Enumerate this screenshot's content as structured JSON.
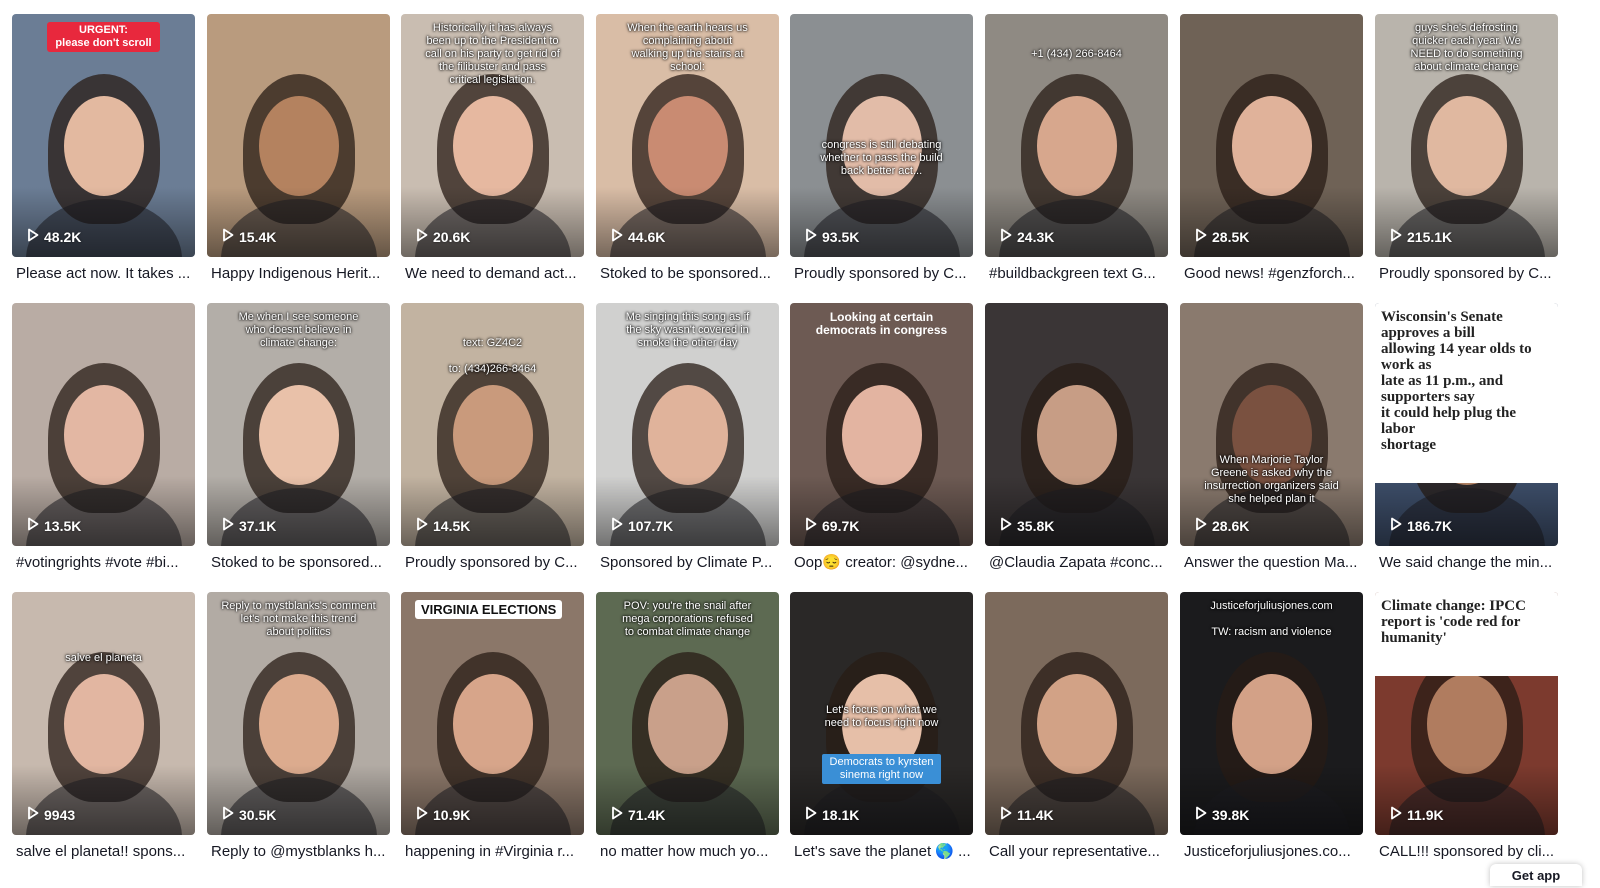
{
  "videos": [
    {
      "views": "48.2K",
      "caption": "Please act now. It takes ...",
      "overlay": "URGENT:\nplease don't scroll",
      "bg": "#6b7d95",
      "skin": "#e3b9a0"
    },
    {
      "views": "15.4K",
      "caption": "Happy Indigenous Herit...",
      "overlay": "",
      "bg": "#b99b7e",
      "skin": "#b4825f"
    },
    {
      "views": "20.6K",
      "caption": "We need to demand act...",
      "overlay": "Historically it has always\nbeen up to the President to\ncall on his party to get rid of\nthe filibuster and pass\ncritical legislation.",
      "bg": "#c9bdb1",
      "skin": "#e6b8a0"
    },
    {
      "views": "44.6K",
      "caption": "Stoked to be sponsored...",
      "overlay": "When the earth hears us\ncomplaining about\nwalking up the stairs at\nschool:",
      "bg": "#d9bda6",
      "skin": "#c98b72"
    },
    {
      "views": "93.5K",
      "caption": "Proudly sponsored by C...",
      "overlay": "\n\n\n\n\n\n\n\n\ncongress is still debating\nwhether to pass the build\nback better act...",
      "bg": "#8b8f92",
      "skin": "#e2bca8"
    },
    {
      "views": "24.3K",
      "caption": "#buildbackgreen text G...",
      "overlay": "\n\n+1 (434) 266-8464",
      "bg": "#8f8a83",
      "skin": "#d7a78d"
    },
    {
      "views": "28.5K",
      "caption": "Good news! #genzforch...",
      "overlay": "",
      "bg": "#6f6256",
      "skin": "#e0b29a"
    },
    {
      "views": "215.1K",
      "caption": "Proudly sponsored by C...",
      "overlay": "guys she's defrosting\nquicker each year. We\nNEED to do something\nabout climate change",
      "bg": "#b9b4ac",
      "skin": "#e0b8a0"
    },
    {
      "views": "13.5K",
      "caption": "#votingrights #vote #bi...",
      "overlay": "",
      "bg": "#b9aca4",
      "skin": "#e3b7a3"
    },
    {
      "views": "37.1K",
      "caption": "Stoked to be sponsored...",
      "overlay": "Me when I see someone\nwho doesnt believe in\nclimate change:",
      "bg": "#b3aea8",
      "skin": "#e9c1a9"
    },
    {
      "views": "14.5K",
      "caption": "Proudly sponsored by C...",
      "overlay": "\n\ntext: GZ4C2\n\n    to: (434)266-8464",
      "bg": "#c2b3a1",
      "skin": "#c99a7c"
    },
    {
      "views": "107.7K",
      "caption": "Sponsored by Climate P...",
      "overlay": "Me singing this song as if\nthe sky wasn't covered in\nsmoke the other day",
      "bg": "#d0d0cf",
      "skin": "#e0b39b"
    },
    {
      "views": "69.7K",
      "caption": "Oop😔 creator: @sydne...",
      "overlay": "Looking at certain\ndemocrats in congress",
      "bg": "#6d5a53",
      "skin": "#e3b4a1"
    },
    {
      "views": "35.8K",
      "caption": "@Claudia Zapata #conc...",
      "overlay": "",
      "bg": "#3a3536",
      "skin": "#c79d85"
    },
    {
      "views": "28.6K",
      "caption": "Answer the question Ma...",
      "overlay": "\n\n\n\n\n\n\n\n\n\n\nWhen Marjorie Taylor\nGreene is asked why the\ninsurrection organizers said\nshe helped plan it",
      "bg": "#8a7a6e",
      "skin": "#7a5140"
    },
    {
      "views": "186.7K",
      "caption": "We said change the min...",
      "overlay": "Wisconsin's Senate approves a bill\nallowing 14 year olds to work as\nlate as 11 p.m., and supporters say\nit could help plug the labor\nshortage",
      "bg": "#3e4f6b",
      "skin": "#b48466"
    },
    {
      "views": "9943",
      "caption": "salve el planeta!! spons...",
      "overlay": "\n\n\n\nsalve el planeta",
      "bg": "#c7b9ae",
      "skin": "#e2b6a1"
    },
    {
      "views": "30.5K",
      "caption": "Reply to @mystblanks h...",
      "overlay": "Reply to mystblanks's comment\nlet's not make this trend\nabout politics",
      "bg": "#b2aba4",
      "skin": "#dcab8e"
    },
    {
      "views": "10.9K",
      "caption": "happening in #Virginia r...",
      "overlay": "VIRGINIA ELECTIONS",
      "bg": "#8b7769",
      "skin": "#d7a58a"
    },
    {
      "views": "71.4K",
      "caption": "no matter how much yo...",
      "overlay": "POV: you're the snail after\nmega corporations refused\nto combat climate change",
      "bg": "#5d6a52",
      "skin": "#c9a08a"
    },
    {
      "views": "18.1K",
      "caption": "Let's save the planet 🌎 ...",
      "overlay": "\n\n\n\n\n\n\n\nLet's focus on what we\nneed to focus right now",
      "bg": "#2a2827",
      "skin": "#e6bfa8"
    },
    {
      "views": "11.4K",
      "caption": "Call your representative...",
      "overlay": "",
      "bg": "#7c6a5c",
      "skin": "#d2a286"
    },
    {
      "views": "39.8K",
      "caption": "Justiceforjuliusjones.co...",
      "overlay": "Justiceforjuliusjones.com\n\nTW: racism and violence",
      "bg": "#1b1b1d",
      "skin": "#d3a187"
    },
    {
      "views": "11.9K",
      "caption": "CALL!!! sponsored by cli...",
      "overlay": "Climate change: IPCC\nreport is 'code red for\nhumanity'",
      "bg": "#7c3a2e",
      "skin": "#b07c5f"
    }
  ],
  "extra_overlays": {
    "democrats_label": "Democrats to kyrsten\nsinema right now"
  },
  "footer": {
    "get_app": "Get app"
  }
}
